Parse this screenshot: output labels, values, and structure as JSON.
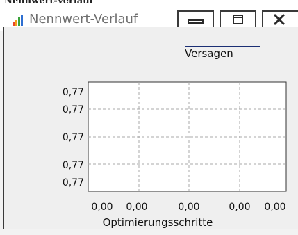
{
  "window": {
    "title": "Nennwert-Verlauf",
    "icon": "bar-chart-app-icon",
    "controls": [
      "minimize-icon",
      "maximize-icon",
      "close-icon"
    ]
  },
  "colors": {
    "legend_line": "#1b2f74",
    "plot_background": "#ffffff",
    "grid": "#a8a8a8",
    "client_background": "#efefef"
  },
  "chart_data": {
    "type": "line",
    "legend": [
      "Versagen"
    ],
    "legend_placement": "top-right",
    "xlabel": "Optimierungsschritte",
    "ylabel": "",
    "x_tick_labels": [
      "0,00",
      "0,00",
      "0,00",
      "0,00",
      "0,00"
    ],
    "y_tick_labels": [
      "0,77",
      "0,77",
      "0,77",
      "0,77",
      "0,77"
    ],
    "grid": true,
    "series": [
      {
        "name": "Versagen",
        "values": []
      }
    ]
  }
}
